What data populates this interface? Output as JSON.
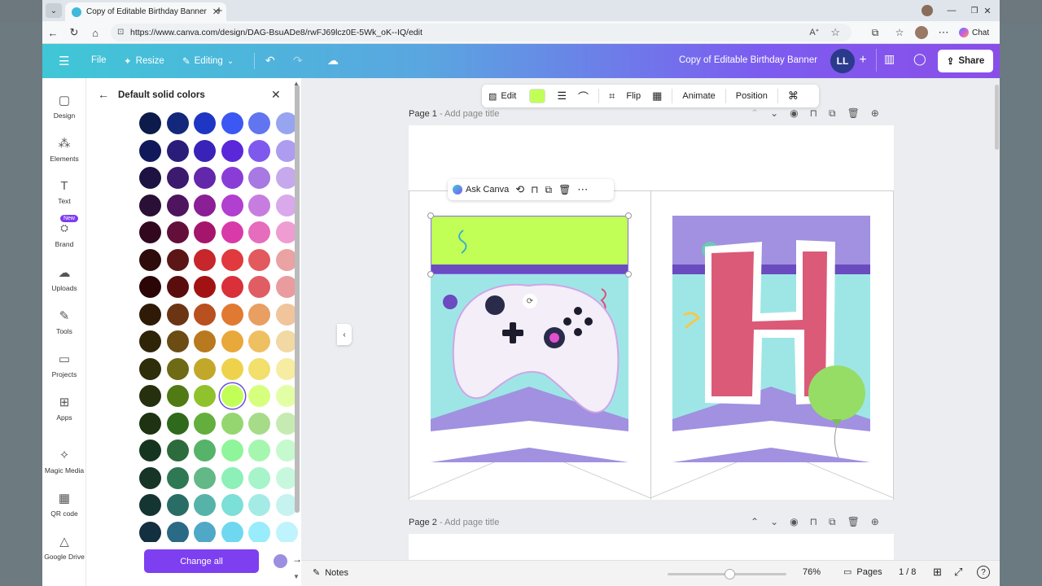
{
  "browser": {
    "tab_title": "Copy of Editable Birthday Banner",
    "url": "https://www.canva.com/design/DAG-BsuADe8/rwFJ69lcz0E-5Wk_oK--IQ/edit",
    "chat_label": "Chat"
  },
  "header": {
    "file": "File",
    "resize": "Resize",
    "editing": "Editing",
    "doc_title": "Copy of Editable Birthday Banner",
    "avatar": "LL",
    "share": "Share"
  },
  "sidebar": {
    "items": [
      {
        "label": "Design",
        "icon": "design-icon"
      },
      {
        "label": "Elements",
        "icon": "elements-icon"
      },
      {
        "label": "Text",
        "icon": "text-icon"
      },
      {
        "label": "Brand",
        "icon": "brand-icon",
        "badge": "New"
      },
      {
        "label": "Uploads",
        "icon": "uploads-icon"
      },
      {
        "label": "Tools",
        "icon": "tools-icon"
      },
      {
        "label": "Projects",
        "icon": "projects-icon"
      },
      {
        "label": "Apps",
        "icon": "apps-icon"
      },
      {
        "label": "Magic Media",
        "icon": "magic-media-icon"
      },
      {
        "label": "QR code",
        "icon": "qr-code-icon"
      },
      {
        "label": "Google Drive",
        "icon": "google-drive-icon"
      }
    ]
  },
  "panel": {
    "title": "Default solid colors",
    "change_all": "Change all",
    "from_color": "#9c8fe0",
    "to_color": "#c1ff57",
    "selected_color": "#c1ff57",
    "swatch_rows": [
      [
        "#0d1b4b",
        "#13287a",
        "#1f36c4",
        "#3b58f2",
        "#6275f0",
        "#97a5f0",
        "#c3cbf4"
      ],
      [
        "#12195a",
        "#2a1d7a",
        "#3922b8",
        "#5a28d8",
        "#7f58ee",
        "#ad9cf0",
        "#d6ccf7"
      ],
      [
        "#1e1242",
        "#3c1a6e",
        "#6327ab",
        "#8a3dd6",
        "#a878e3",
        "#c6a9ec",
        "#e2d5f4"
      ],
      [
        "#2a0f36",
        "#4e155e",
        "#8a1f96",
        "#b13fcf",
        "#c77de0",
        "#d9a9ec",
        "#ecd4f5"
      ],
      [
        "#32081f",
        "#62103a",
        "#a5156b",
        "#d93aa9",
        "#e66cbd",
        "#ef9cd2",
        "#f5c9e4"
      ],
      [
        "#2e0c0c",
        "#5c1616",
        "#c7262a",
        "#e0393e",
        "#e25a5e",
        "#eaa2a2",
        "#f3cdcd"
      ],
      [
        "#2c0606",
        "#5a0d0d",
        "#a31212",
        "#d9303a",
        "#e05d64",
        "#e99b9e",
        "#f4c8ca"
      ],
      [
        "#2e1a06",
        "#6b3513",
        "#b8501f",
        "#e07a32",
        "#e99e62",
        "#f0c59c",
        "#f6e0c8"
      ],
      [
        "#2e2408",
        "#6b4c13",
        "#b8791f",
        "#e8a83a",
        "#efc062",
        "#f2d8a2",
        "#f7ead0"
      ],
      [
        "#2e2e0a",
        "#6e6a15",
        "#c2a82a",
        "#eed24c",
        "#f2df6c",
        "#f6eca2",
        "#faf5d0"
      ],
      [
        "#26300e",
        "#4f7a14",
        "#8fc22c",
        "#c1ff57",
        "#d6ff7e",
        "#e3ffa6",
        "#eefcd0"
      ],
      [
        "#1d3311",
        "#2f6a1c",
        "#64ae3e",
        "#95d670",
        "#a6dc88",
        "#c6ebb2",
        "#e0f5d4"
      ],
      [
        "#163520",
        "#2c6b3b",
        "#56b36a",
        "#8ff59a",
        "#a5f7b0",
        "#c7f9cf",
        "#e2fce6"
      ],
      [
        "#163526",
        "#2f7854",
        "#62b886",
        "#8cf0b8",
        "#a7f4ca",
        "#c7f8de",
        "#e3fcef"
      ],
      [
        "#153532",
        "#2a6d67",
        "#56b3a9",
        "#7cdfd8",
        "#a4ebe5",
        "#c6f3ef",
        "#e1faf7"
      ],
      [
        "#123040",
        "#2a6a85",
        "#4fa8c6",
        "#6fd8f0",
        "#98ecfb",
        "#bff3fd",
        "#def9fe"
      ]
    ]
  },
  "toolbar": {
    "edit": "Edit",
    "fill_color": "#c1ff57",
    "flip": "Flip",
    "animate": "Animate",
    "position": "Position"
  },
  "element_toolbar": {
    "ask_canva": "Ask Canva"
  },
  "pages": [
    {
      "label": "Page 1",
      "add_title": "- Add page title"
    },
    {
      "label": "Page 2",
      "add_title": "- Add page title"
    }
  ],
  "banner": {
    "letter": "H",
    "top_band_color": "#c1ff57",
    "stripe_color": "#6a4bc0",
    "bg_color": "#9ee6e6",
    "chevron_color": "#a191e0"
  },
  "footer": {
    "notes": "Notes",
    "zoom": "76%",
    "zoom_fraction": 0.52,
    "pages": "Pages",
    "page_count": "1 / 8"
  }
}
